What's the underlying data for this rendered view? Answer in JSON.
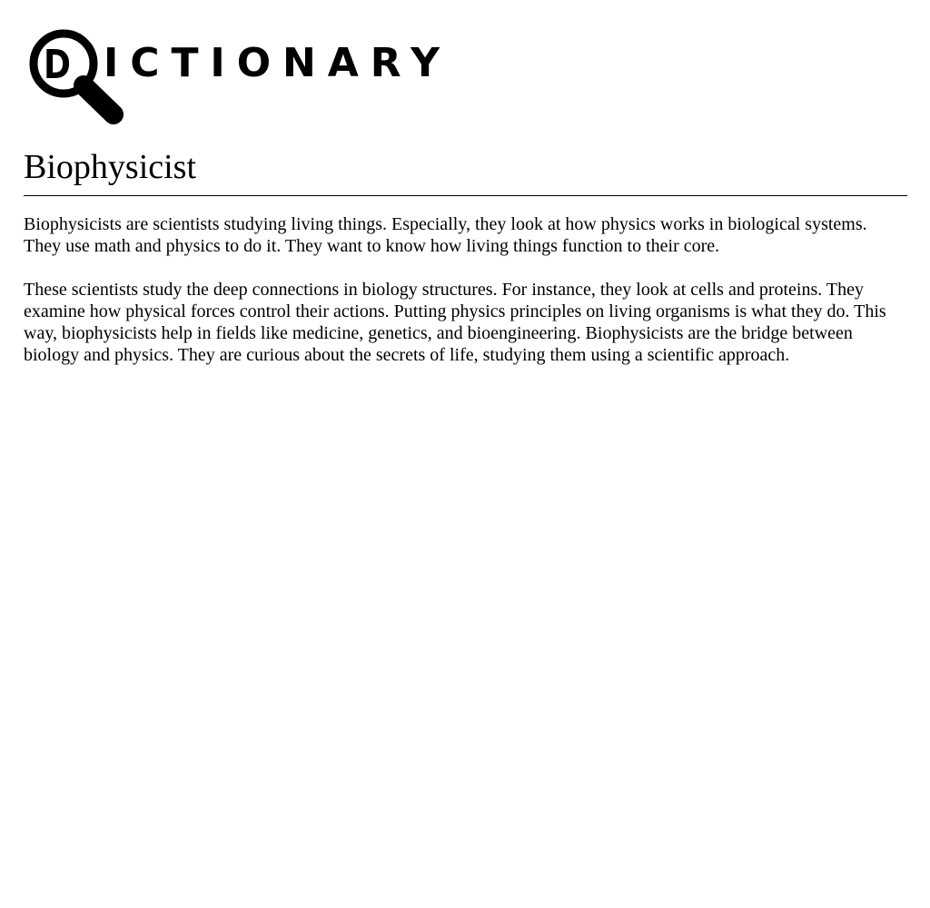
{
  "logo": {
    "text": "DICTIONARY",
    "icon": "magnifying-glass-icon"
  },
  "entry": {
    "title": "Biophysicist",
    "paragraphs": [
      "Biophysicists are scientists studying living things. Especially, they look at how physics works in biological systems. They use math and physics to do it. They want to know how living things function to their core.",
      "These scientists study the deep connections in biology structures. For instance, they look at cells and proteins. They examine how physical forces control their actions. Putting physics principles on living organisms is what they do. This way, biophysicists help in fields like medicine, genetics, and bioengineering. Biophysicists are the bridge between biology and physics. They are curious about the secrets of life, studying them using a scientific approach."
    ]
  }
}
